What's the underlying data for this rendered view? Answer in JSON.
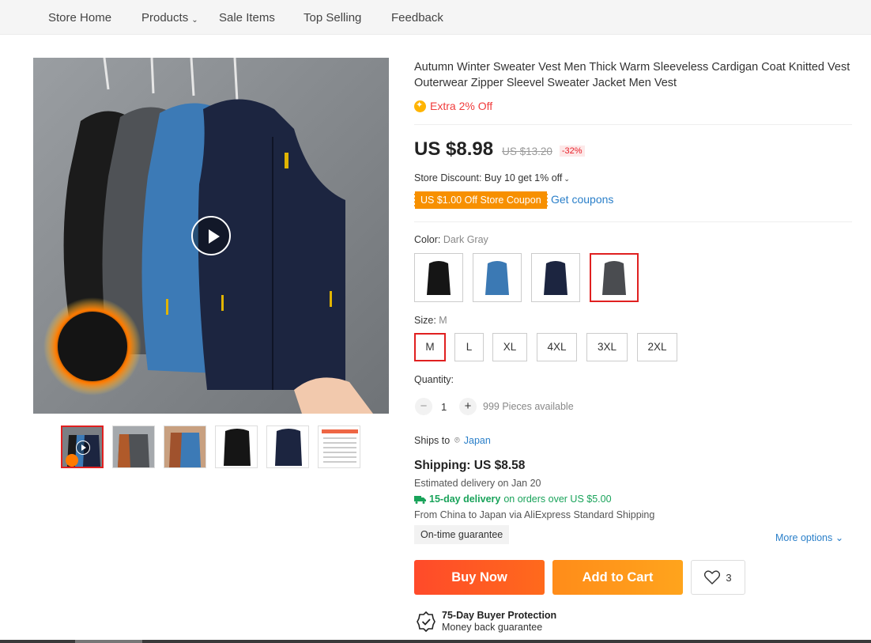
{
  "nav": {
    "items": [
      "Store Home",
      "Products",
      "Sale Items",
      "Top Selling",
      "Feedback"
    ]
  },
  "product": {
    "title": "Autumn Winter Sweater Vest Men Thick Warm Sleeveless Cardigan Coat Knitted Vest Outerwear Zipper Sleevel Sweater Jacket Men Vest",
    "extra_off": "Extra 2% Off",
    "price": "US $8.98",
    "original_price": "US $13.20",
    "discount": "-32%",
    "store_discount": "Store Discount: Buy 10 get 1% off",
    "coupon": "US $1.00 Off Store Coupon",
    "get_coupons": "Get coupons"
  },
  "color": {
    "label": "Color:",
    "selected": "Dark Gray",
    "options": [
      "black",
      "blue",
      "navy",
      "dark-gray"
    ],
    "swatch_colors": [
      "#151515",
      "#3b79b4",
      "#1c2540",
      "#4a4c50"
    ]
  },
  "size": {
    "label": "Size:",
    "selected": "M",
    "options": [
      "M",
      "L",
      "XL",
      "4XL",
      "3XL",
      "2XL"
    ]
  },
  "quantity": {
    "label": "Quantity:",
    "minus": "−",
    "plus": "+",
    "value": "1",
    "available": "999 Pieces available"
  },
  "shipping": {
    "ships_to_label": "Ships to",
    "country": "Japan",
    "title": "Shipping: US $8.58",
    "estimated": "Estimated delivery on Jan 20",
    "fast_bold": "15-day delivery",
    "fast_rest": "on orders over US $5.00",
    "from": "From China to Japan via AliExpress Standard Shipping",
    "guarantee": "On-time guarantee",
    "more_options": "More options"
  },
  "actions": {
    "buy_now": "Buy Now",
    "add_to_cart": "Add to Cart",
    "wishlist_count": "3"
  },
  "protection": {
    "title": "75-Day Buyer Protection",
    "subtitle": "Money back guarantee"
  },
  "colors": {
    "accent_red": "#e02020",
    "buy_now": "#ff4a2a",
    "add_cart": "#ff9a1c",
    "link_blue": "#2a7fc9",
    "coupon_orange": "#f79000",
    "green": "#19a35a"
  }
}
